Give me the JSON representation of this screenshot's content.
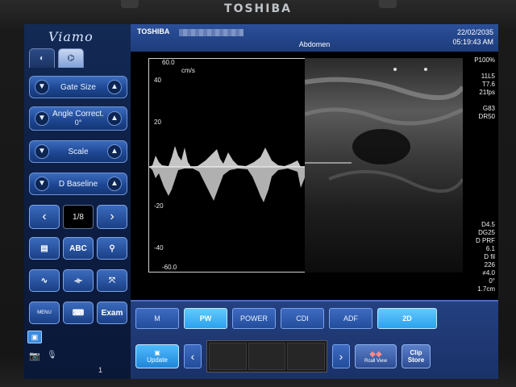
{
  "device": {
    "brand": "TOSHIBA"
  },
  "sidebar": {
    "logo": "Viamo",
    "tabs": [
      "◐",
      "⌬"
    ],
    "controls": [
      {
        "label": "Gate Size",
        "value": ""
      },
      {
        "label": "Angle Correct.",
        "value": "0°"
      },
      {
        "label": "Scale",
        "value": ""
      },
      {
        "label": "D Baseline",
        "value": ""
      }
    ],
    "pager": {
      "prev": "‹",
      "value": "1/8",
      "next": "›"
    },
    "row1": [
      "▤",
      "ABC",
      "⚲"
    ],
    "row2": [
      "∿",
      "⟛",
      "⤧"
    ],
    "row3": [
      {
        "label": "MENU"
      },
      {
        "label": "⌨"
      },
      {
        "label": "Exam"
      }
    ],
    "mini_icon": "▣",
    "camera_icon": "📷",
    "mic_icon": "🎙",
    "disk_text": "1"
  },
  "header": {
    "brand": "TOSHIBA",
    "preset": "Abdomen",
    "date": "22/02/2035",
    "time": "05:19:43 AM"
  },
  "doppler": {
    "top_scale": "60.0",
    "unit": "cm/s",
    "ticks": [
      "40",
      "20",
      "-20",
      "-40"
    ],
    "bottom_scale": "-60.0",
    "top_marker": "0",
    "bottom_marker": "4"
  },
  "params_top": [
    "P100%",
    "",
    "11L5",
    "T7.6",
    "21fps",
    "",
    "G83",
    "DR50"
  ],
  "params_bottom": [
    "D4.5",
    "DG25",
    "D PRF",
    "6.1",
    "D fil",
    "226",
    "≠4.0",
    "0°",
    "1.7cm"
  ],
  "bottom_bar": {
    "modes": [
      {
        "label": "M",
        "on": false
      },
      {
        "label": "PW",
        "on": true
      },
      {
        "label": "POWER",
        "on": false
      },
      {
        "label": "CDI",
        "on": false
      },
      {
        "label": "ADF",
        "on": false
      },
      {
        "label": "2D",
        "on": true
      }
    ],
    "update": "Update",
    "prev": "‹",
    "next": "›",
    "rv": "Rcall View",
    "clip_store": "Clip Store"
  }
}
